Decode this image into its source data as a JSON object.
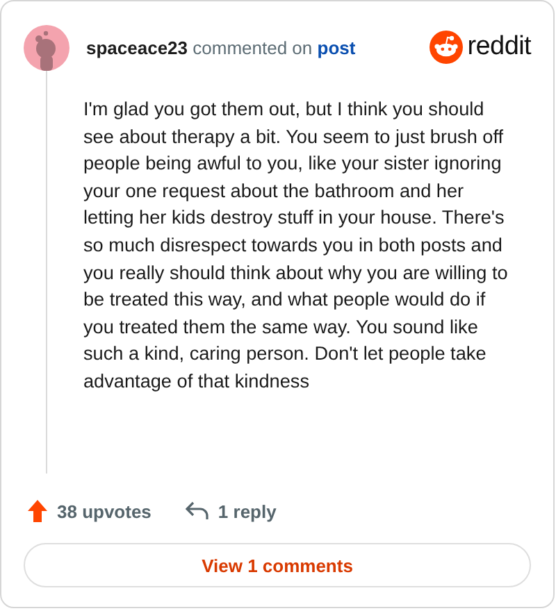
{
  "comment": {
    "author": "spaceace23",
    "action": "commented on",
    "target": "post",
    "brand": "reddit",
    "body": "I'm glad you got them out, but I think you should see about therapy a bit. You seem to just brush off people being awful to you, like your sister ignoring your one request about the bathroom and her letting her kids destroy stuff in your house. There's so much disrespect towards you in both posts and you really should think about why you are willing to be treated this way, and what people would do if you treated them the same way. You sound like such a kind, caring person. Don't let people take advantage of that kindness",
    "upvotes": "38 upvotes",
    "replies": "1 reply",
    "view_button": "View 1 comments"
  }
}
